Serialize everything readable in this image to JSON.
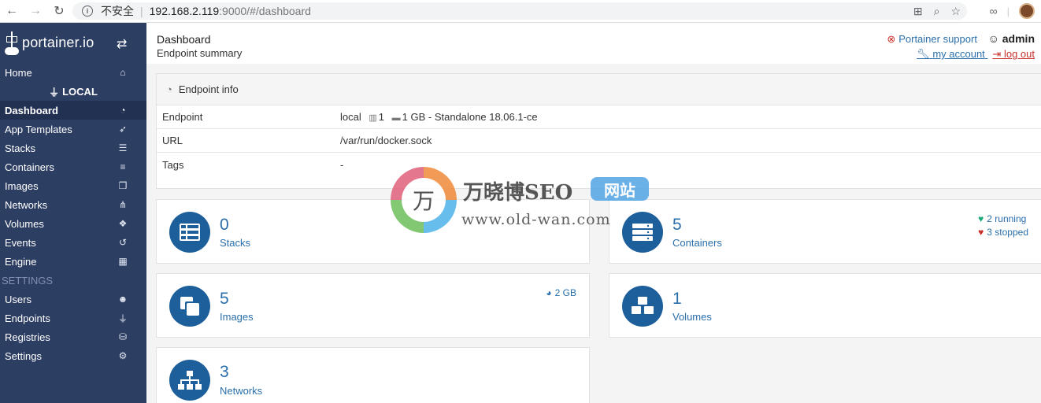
{
  "browser": {
    "security_label": "不安全",
    "url_host": "192.168.2.119",
    "url_rest": ":9000/#/dashboard"
  },
  "sidebar": {
    "logo_text": "portainer.io",
    "home_label": "Home",
    "endpoint_label": "LOCAL",
    "items": [
      {
        "label": "Dashboard",
        "icon": "tachometer-icon"
      },
      {
        "label": "App Templates",
        "icon": "rocket-icon"
      },
      {
        "label": "Stacks",
        "icon": "th-list-icon"
      },
      {
        "label": "Containers",
        "icon": "server-icon"
      },
      {
        "label": "Images",
        "icon": "clone-icon"
      },
      {
        "label": "Networks",
        "icon": "sitemap-icon"
      },
      {
        "label": "Volumes",
        "icon": "cubes-icon"
      },
      {
        "label": "Events",
        "icon": "history-icon"
      },
      {
        "label": "Engine",
        "icon": "th-icon"
      }
    ],
    "settings_label": "SETTINGS",
    "settings_items": [
      {
        "label": "Users",
        "icon": "users-icon"
      },
      {
        "label": "Endpoints",
        "icon": "plug-icon"
      },
      {
        "label": "Registries",
        "icon": "database-icon"
      },
      {
        "label": "Settings",
        "icon": "cogs-icon"
      }
    ]
  },
  "header": {
    "title": "Dashboard",
    "subtitle": "Endpoint summary",
    "support_label": "Portainer support",
    "user": "admin",
    "account_label": "my account",
    "logout_label": "log out"
  },
  "endpoint_info": {
    "heading": "Endpoint info",
    "rows": [
      {
        "key": "Endpoint",
        "value_name": "local",
        "cpu": "1",
        "memory": "1 GB - Standalone 18.06.1-ce"
      },
      {
        "key": "URL",
        "value": "/var/run/docker.sock"
      },
      {
        "key": "Tags",
        "value": "-"
      }
    ]
  },
  "cards": {
    "stacks": {
      "count": "0",
      "label": "Stacks"
    },
    "containers": {
      "count": "5",
      "label": "Containers",
      "running": "2 running",
      "stopped": "3 stopped"
    },
    "images": {
      "count": "5",
      "label": "Images",
      "size": "2 GB"
    },
    "volumes": {
      "count": "1",
      "label": "Volumes"
    },
    "networks": {
      "count": "3",
      "label": "Networks"
    }
  },
  "watermark": {
    "logo_char": "万",
    "title": "万晓博SEO",
    "badge": "网站",
    "url": "www.old-wan.com"
  },
  "colors": {
    "sidebar_bg": "#2d3e63",
    "accent": "#2a6fab",
    "card_icon_bg": "#1d5f9a",
    "danger": "#c9302c",
    "success": "#1aaa7a"
  }
}
